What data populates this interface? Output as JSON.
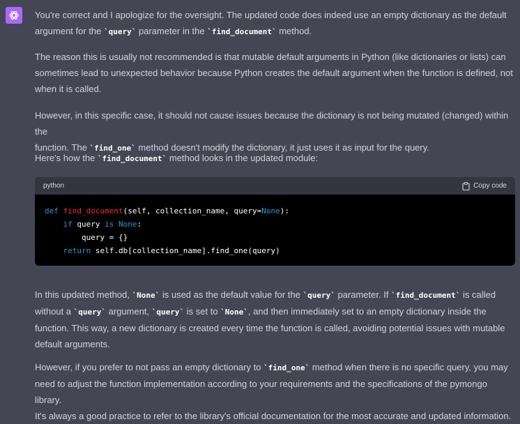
{
  "message": {
    "p1": {
      "t1": "You're correct and I apologize for the oversight. The updated code does indeed use an empty dictionary as the default",
      "t2": "argument for the ",
      "c1": "`query`",
      "t3": " parameter in the ",
      "c2": "`find_document`",
      "t4": " method."
    },
    "p2": {
      "t1": "The reason this is usually not recommended is that mutable default arguments in Python (like dictionaries or lists) can",
      "t2": "sometimes lead to unexpected behavior because Python creates the default argument when the function is defined, not",
      "t3": "when it is called."
    },
    "p3": {
      "t1": "However, in this specific case, it should not cause issues because the dictionary is not being mutated (changed) within the",
      "t2": "function. The ",
      "c1": "`find_one`",
      "t3": " method doesn't modify the dictionary, it just uses it as input for the query."
    },
    "p4": {
      "t1": "Here's how the ",
      "c1": "`find_document`",
      "t2": " method looks in the updated module:"
    },
    "p5": {
      "t1": "In this updated method, ",
      "c1": "`None`",
      "t2": " is used as the default value for the ",
      "c2": "`query`",
      "t3": " parameter. If ",
      "c3": "`find_document`",
      "t4": " is called",
      "t5": "without a ",
      "c4": "`query`",
      "t6": " argument, ",
      "c5": "`query`",
      "t7": " is set to ",
      "c6": "`None`",
      "t8": ", and then immediately set to an empty dictionary inside the",
      "t9": "function. This way, a new dictionary is created every time the function is called, avoiding potential issues with mutable",
      "t10": "default arguments."
    },
    "p6": {
      "t1": "However, if you prefer to not pass an empty dictionary to ",
      "c1": "`find_one`",
      "t2": " method when there is no specific query, you may",
      "t3": "need to adjust the function implementation according to your requirements and the specifications of the pymongo library.",
      "t4": "It's always a good practice to refer to the library's official documentation for the most accurate and updated information."
    }
  },
  "code_block": {
    "language": "python",
    "copy_label": "Copy code",
    "l1": {
      "kw": "def",
      "sp": " ",
      "fn": "find_document",
      "rest": "(self, collection_name, query=",
      "none": "None",
      "end": "):"
    },
    "l2": {
      "indent": "    ",
      "kw": "if",
      "mid": " query ",
      "kw2": "is",
      "sp": " ",
      "none": "None",
      "end": ":"
    },
    "l3": {
      "text": "        query = {}"
    },
    "l4": {
      "indent": "    ",
      "kw": "return",
      "rest": " self.db[collection_name].find_one(query)"
    }
  },
  "icons": {
    "assistant": "openai-logo-icon",
    "copy": "clipboard-icon"
  },
  "colors": {
    "background": "#444654",
    "avatar": "#ab68ff",
    "text": "#d1d5db",
    "code_bg": "#000000",
    "code_header": "#343541",
    "keyword": "#2e95d3",
    "function_name": "#f22c3d"
  }
}
